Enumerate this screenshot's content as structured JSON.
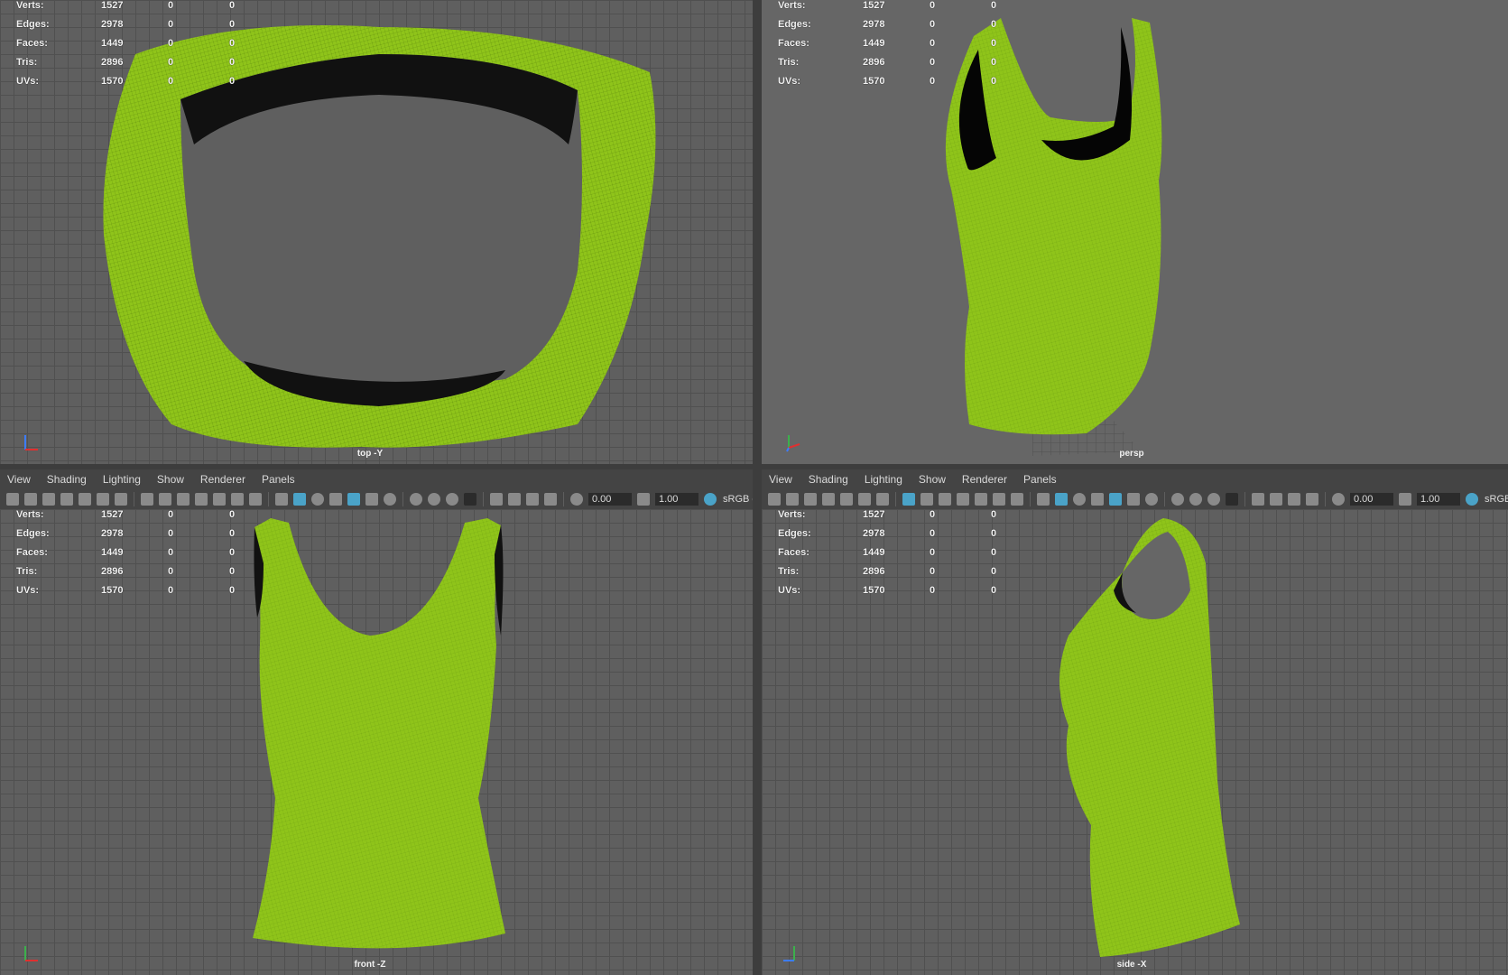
{
  "panels": [
    {
      "id": "top",
      "camera_label": "top -Y",
      "stats": [
        {
          "label": "Verts:",
          "value": "1527",
          "z1": "0",
          "z2": "0"
        },
        {
          "label": "Edges:",
          "value": "2978",
          "z1": "0",
          "z2": "0"
        },
        {
          "label": "Faces:",
          "value": "1449",
          "z1": "0",
          "z2": "0"
        },
        {
          "label": "Tris:",
          "value": "2896",
          "z1": "0",
          "z2": "0"
        },
        {
          "label": "UVs:",
          "value": "1570",
          "z1": "0",
          "z2": "0"
        }
      ]
    },
    {
      "id": "persp",
      "camera_label": "persp",
      "stats": [
        {
          "label": "Verts:",
          "value": "1527",
          "z1": "0",
          "z2": "0"
        },
        {
          "label": "Edges:",
          "value": "2978",
          "z1": "0",
          "z2": "0"
        },
        {
          "label": "Faces:",
          "value": "1449",
          "z1": "0",
          "z2": "0"
        },
        {
          "label": "Tris:",
          "value": "2896",
          "z1": "0",
          "z2": "0"
        },
        {
          "label": "UVs:",
          "value": "1570",
          "z1": "0",
          "z2": "0"
        }
      ]
    },
    {
      "id": "front",
      "camera_label": "front -Z",
      "stats": [
        {
          "label": "Verts:",
          "value": "1527",
          "z1": "0",
          "z2": "0"
        },
        {
          "label": "Edges:",
          "value": "2978",
          "z1": "0",
          "z2": "0"
        },
        {
          "label": "Faces:",
          "value": "1449",
          "z1": "0",
          "z2": "0"
        },
        {
          "label": "Tris:",
          "value": "2896",
          "z1": "0",
          "z2": "0"
        },
        {
          "label": "UVs:",
          "value": "1570",
          "z1": "0",
          "z2": "0"
        }
      ]
    },
    {
      "id": "side",
      "camera_label": "side -X",
      "stats": [
        {
          "label": "Verts:",
          "value": "1527",
          "z1": "0",
          "z2": "0"
        },
        {
          "label": "Edges:",
          "value": "2978",
          "z1": "0",
          "z2": "0"
        },
        {
          "label": "Faces:",
          "value": "1449",
          "z1": "0",
          "z2": "0"
        },
        {
          "label": "Tris:",
          "value": "2896",
          "z1": "0",
          "z2": "0"
        },
        {
          "label": "UVs:",
          "value": "1570",
          "z1": "0",
          "z2": "0"
        }
      ]
    }
  ],
  "menus": [
    "View",
    "Shading",
    "Lighting",
    "Show",
    "Renderer",
    "Panels"
  ],
  "toolbar": {
    "exposure_value": "0.00",
    "gamma_value": "1.00",
    "colorspace_left": "sRGB g",
    "colorspace_right": "sRGB"
  },
  "colors": {
    "garment": "#8fc41a",
    "garment_shade": "#5e8a0c",
    "interior": "#050505",
    "accent": "#4aa3c8"
  }
}
